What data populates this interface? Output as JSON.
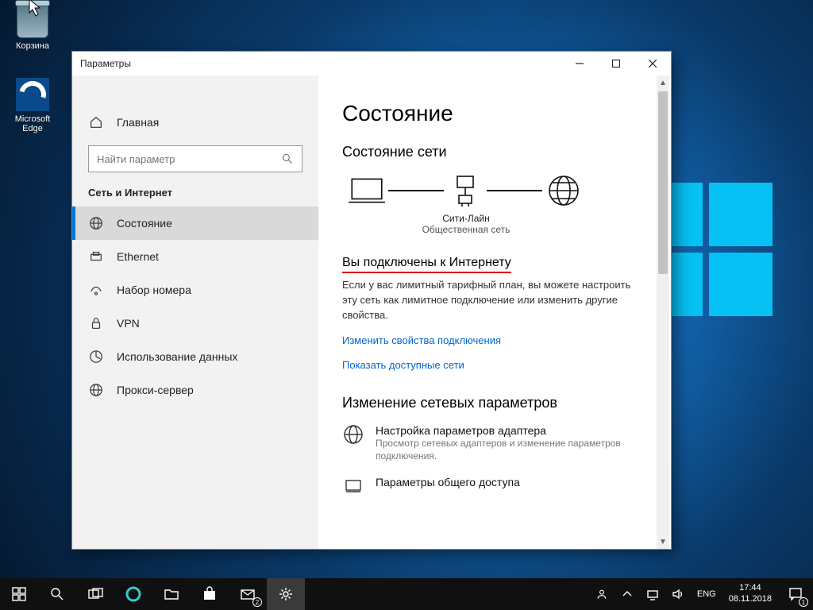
{
  "desktop": {
    "recycle_label": "Корзина",
    "edge_label": "Microsoft Edge"
  },
  "window": {
    "title": "Параметры",
    "home": "Главная",
    "search_placeholder": "Найти параметр",
    "category": "Сеть и Интернет",
    "nav": [
      {
        "id": "status",
        "label": "Состояние",
        "selected": true
      },
      {
        "id": "ethernet",
        "label": "Ethernet",
        "selected": false
      },
      {
        "id": "dialup",
        "label": "Набор номера",
        "selected": false
      },
      {
        "id": "vpn",
        "label": "VPN",
        "selected": false
      },
      {
        "id": "datausage",
        "label": "Использование данных",
        "selected": false
      },
      {
        "id": "proxy",
        "label": "Прокси-сервер",
        "selected": false
      }
    ],
    "content": {
      "h1": "Состояние",
      "h2": "Состояние сети",
      "network_name": "Сити-Лайн",
      "network_type": "Общественная сеть",
      "connected_heading": "Вы подключены к Интернету",
      "connected_text": "Если у вас лимитный тарифный план, вы можете настроить эту сеть как лимитное подключение или изменить другие свойства.",
      "link_change": "Изменить свойства подключения",
      "link_show": "Показать доступные сети",
      "change_h2": "Изменение сетевых параметров",
      "adapter_title": "Настройка параметров адаптера",
      "adapter_desc": "Просмотр сетевых адаптеров и изменение параметров подключения.",
      "sharing_title": "Параметры общего доступа"
    }
  },
  "taskbar": {
    "lang": "ENG",
    "time": "17:44",
    "date": "08.11.2018",
    "notif_count": "1"
  }
}
